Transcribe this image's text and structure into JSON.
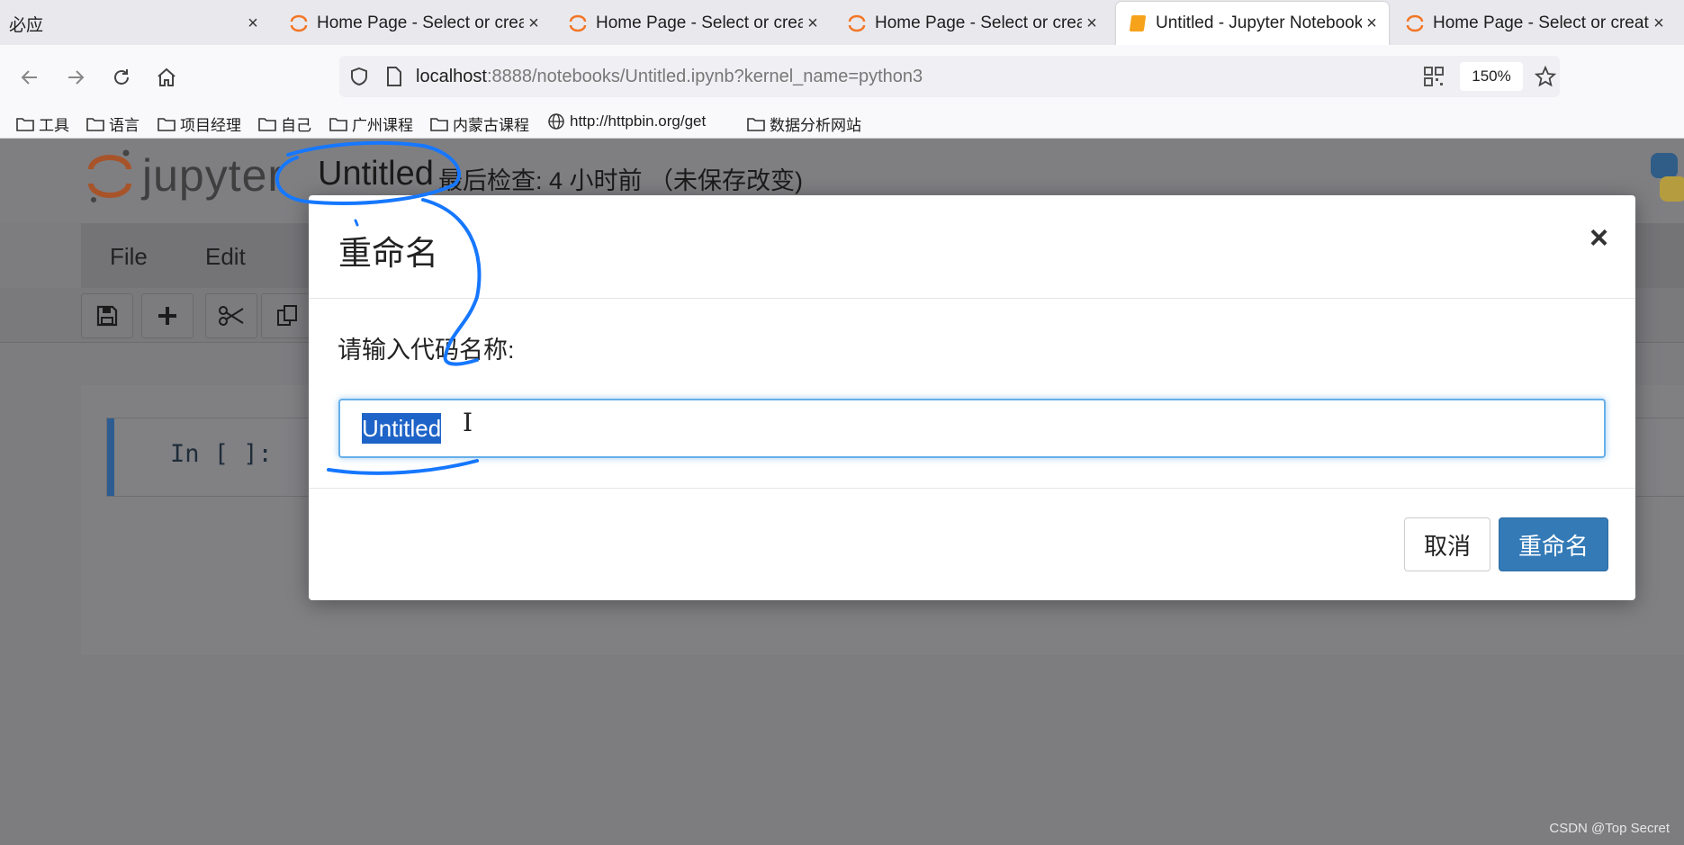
{
  "browser": {
    "tabs": [
      {
        "title": "必应",
        "icon": "none",
        "active": false
      },
      {
        "title": "Home Page - Select or create",
        "icon": "jupyter-icon",
        "active": false
      },
      {
        "title": "Home Page - Select or create",
        "icon": "jupyter-icon",
        "active": false
      },
      {
        "title": "Home Page - Select or create",
        "icon": "jupyter-icon",
        "active": false
      },
      {
        "title": "Untitled - Jupyter Notebook",
        "icon": "notebook-icon",
        "active": true
      },
      {
        "title": "Home Page - Select or create",
        "icon": "jupyter-icon",
        "active": false
      }
    ],
    "url_host": "localhost",
    "url_rest": ":8888/notebooks/Untitled.ipynb?kernel_name=python3",
    "zoom": "150%",
    "bookmarks": [
      {
        "label": "工具",
        "icon": "folder-icon"
      },
      {
        "label": "语言",
        "icon": "folder-icon"
      },
      {
        "label": "项目经理",
        "icon": "folder-icon"
      },
      {
        "label": "自己",
        "icon": "folder-icon"
      },
      {
        "label": "广州课程",
        "icon": "folder-icon"
      },
      {
        "label": "内蒙古课程",
        "icon": "folder-icon"
      },
      {
        "label": "http://httpbin.org/get",
        "icon": "globe-icon"
      },
      {
        "label": "数据分析网站",
        "icon": "folder-icon"
      }
    ]
  },
  "jupyter": {
    "logo_text": "jupyter",
    "notebook_name": "Untitled",
    "checkpoint": "最后检查: 4 小时前 （未保存改变)",
    "menu": [
      "File",
      "Edit"
    ],
    "toolbar_icons": [
      "save-icon",
      "plus-icon",
      "cut-icon",
      "copy-icon"
    ],
    "cell_prompt": "In [ ]:"
  },
  "modal": {
    "title": "重命名",
    "close": "×",
    "label": "请输入代码名称:",
    "input_value": "Untitled",
    "cancel_label": "取消",
    "confirm_label": "重命名"
  },
  "watermark": "CSDN @Top Secret",
  "colors": {
    "primary_button": "#337ab7",
    "selection": "#1e64c8",
    "annotation_ink": "#1677ff",
    "overlay_bg": "#7d7d80"
  }
}
